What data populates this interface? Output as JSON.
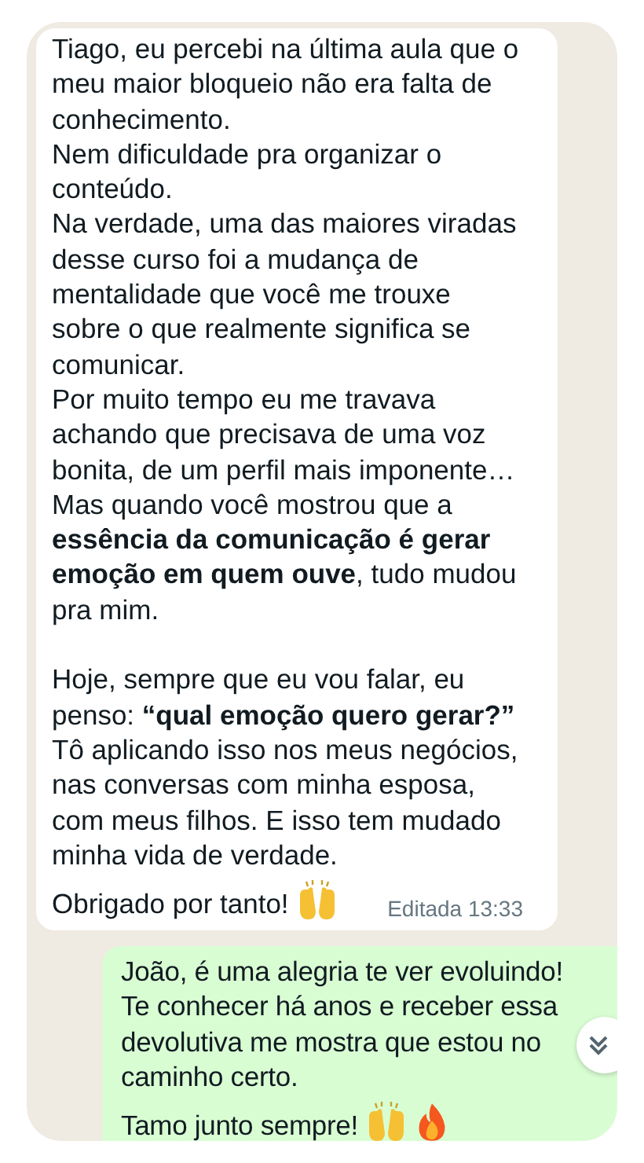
{
  "messages": [
    {
      "kind": "incoming",
      "paragraphs": [
        {
          "text": "Tiago, eu percebi na última aula que o meu maior bloqueio não era falta de conhecimento.",
          "spaced": false
        },
        {
          "text": "Nem dificuldade pra organizar o conteúdo.",
          "spaced": false
        },
        {
          "text": "Na verdade, uma das maiores viradas desse curso foi a mudança de mentalidade que você me trouxe sobre o que realmente significa se comunicar.",
          "spaced": false
        },
        {
          "text": "Por muito tempo eu me travava achando que precisava de uma voz bonita, de um perfil mais imponente…",
          "spaced": false
        },
        {
          "text": "Mas quando você mostrou que a **essência da comunicação é gerar emoção em quem ouve**, tudo mudou pra mim.",
          "spaced": false
        },
        {
          "text": "Hoje, sempre que eu vou falar, eu penso: **“qual emoção quero gerar?”**",
          "spaced": true
        },
        {
          "text": "Tô aplicando isso nos meus negócios, nas conversas com minha esposa, com meus filhos. E isso tem mudado minha vida de verdade.",
          "spaced": false
        }
      ],
      "last_line": "Obrigado por tanto!",
      "emojis": [
        {
          "kind": "hands"
        }
      ],
      "meta": "Editada 13:33"
    },
    {
      "kind": "outgoing",
      "paragraphs": [
        {
          "text": "João, é uma alegria te ver evoluindo!",
          "spaced": false
        },
        {
          "text": "Te conhecer há anos e receber essa devolutiva me mostra que estou no caminho certo.",
          "spaced": false
        }
      ],
      "last_line": "Tamo junto sempre!",
      "emojis": [
        {
          "kind": "hands"
        },
        {
          "kind": "fire"
        }
      ]
    }
  ],
  "scroll_button": true
}
